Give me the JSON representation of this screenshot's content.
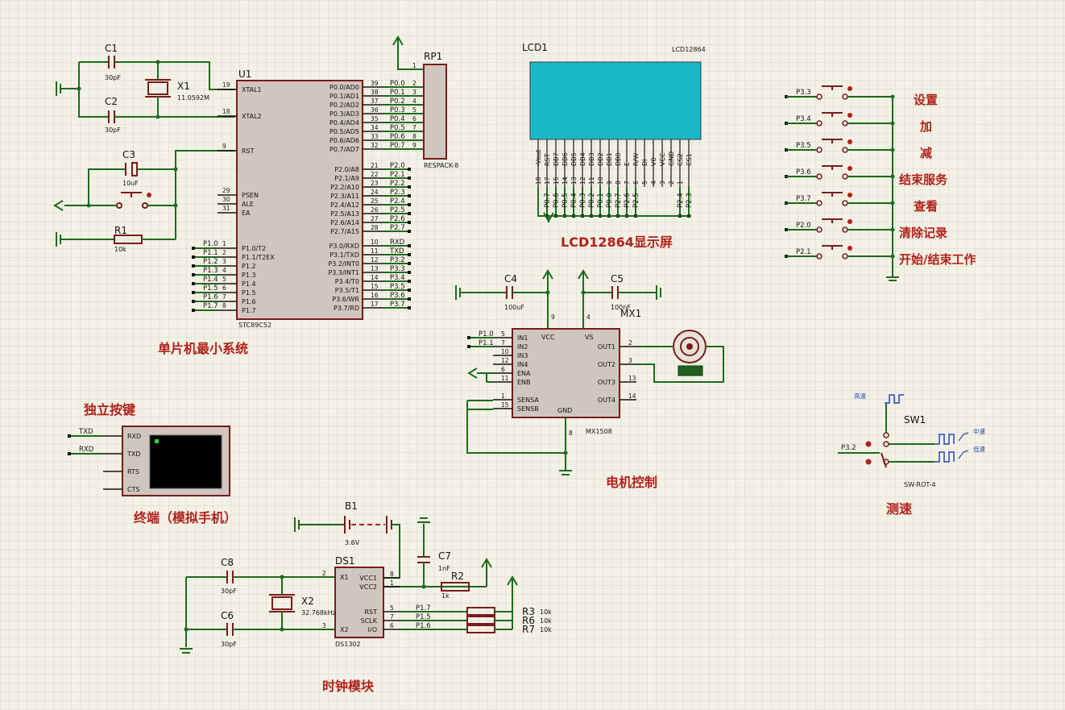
{
  "mcu": {
    "ref": "U1",
    "part": "STC89C52",
    "left_pins": [
      {
        "num": "19",
        "name": "XTAL1"
      },
      {
        "num": "18",
        "name": "XTAL2"
      },
      {
        "num": "9",
        "name": "RST"
      },
      {
        "num": "29",
        "name": "PSEN"
      },
      {
        "num": "30",
        "name": "ALE"
      },
      {
        "num": "31",
        "name": "EA"
      },
      {
        "num": "1",
        "name": "P1.0/T2"
      },
      {
        "num": "2",
        "name": "P1.1/T2EX"
      },
      {
        "num": "3",
        "name": "P1.2"
      },
      {
        "num": "4",
        "name": "P1.3"
      },
      {
        "num": "5",
        "name": "P1.4"
      },
      {
        "num": "6",
        "name": "P1.5"
      },
      {
        "num": "7",
        "name": "P1.6"
      },
      {
        "num": "8",
        "name": "P1.7"
      }
    ],
    "right_pins": [
      {
        "num": "39",
        "name": "P0.0/AD0",
        "net": "P0.0"
      },
      {
        "num": "38",
        "name": "P0.1/AD1",
        "net": "P0.1"
      },
      {
        "num": "37",
        "name": "P0.2/AD2",
        "net": "P0.2"
      },
      {
        "num": "36",
        "name": "P0.3/AD3",
        "net": "P0.3"
      },
      {
        "num": "35",
        "name": "P0.4/AD4",
        "net": "P0.4"
      },
      {
        "num": "34",
        "name": "P0.5/AD5",
        "net": "P0.5"
      },
      {
        "num": "33",
        "name": "P0.6/AD6",
        "net": "P0.6"
      },
      {
        "num": "32",
        "name": "P0.7/AD7",
        "net": "P0.7"
      },
      {
        "num": "21",
        "name": "P2.0/A8",
        "net": "P2.0"
      },
      {
        "num": "22",
        "name": "P2.1/A9",
        "net": "P2.1"
      },
      {
        "num": "23",
        "name": "P2.2/A10",
        "net": "P2.2"
      },
      {
        "num": "24",
        "name": "P2.3/A11",
        "net": "P2.3"
      },
      {
        "num": "25",
        "name": "P2.4/A12",
        "net": "P2.4"
      },
      {
        "num": "26",
        "name": "P2.5/A13",
        "net": "P2.5"
      },
      {
        "num": "27",
        "name": "P2.6/A14",
        "net": "P2.6"
      },
      {
        "num": "28",
        "name": "P2.7/A15",
        "net": "P2.7"
      },
      {
        "num": "10",
        "name": "P3.0/RXD",
        "net": "RXD"
      },
      {
        "num": "11",
        "name": "P3.1/TXD",
        "net": "TXD"
      },
      {
        "num": "12",
        "name": "P3.2/INT0",
        "net": "P3.2"
      },
      {
        "num": "13",
        "name": "P3.3/INT1",
        "net": "P3.3"
      },
      {
        "num": "14",
        "name": "P3.4/T0",
        "net": "P3.4"
      },
      {
        "num": "15",
        "name": "P3.5/T1",
        "net": "P3.5"
      },
      {
        "num": "16",
        "name": "P3.6/WR",
        "net": "P3.6"
      },
      {
        "num": "17",
        "name": "P3.7/RD",
        "net": "P3.7"
      }
    ],
    "p1_nets": [
      "P1.0",
      "P1.1",
      "P1.2",
      "P1.3",
      "P1.4",
      "P1.5",
      "P1.6",
      "P1.7"
    ]
  },
  "parts": {
    "c1": {
      "ref": "C1",
      "value": "30pF"
    },
    "c2": {
      "ref": "C2",
      "value": "30pF"
    },
    "c3": {
      "ref": "C3",
      "value": "10uF"
    },
    "x1": {
      "ref": "X1",
      "value": "11.0592M"
    },
    "r1": {
      "ref": "R1",
      "value": "10k"
    },
    "rp1": {
      "ref": "RP1",
      "value": "RESPACK-8",
      "pins": [
        "1",
        "2",
        "3",
        "4",
        "5",
        "6",
        "7",
        "8",
        "9"
      ]
    },
    "lcd": {
      "ref": "LCD1",
      "part": "LCD12864",
      "pins": [
        "-Vout",
        "RST",
        "DB7",
        "DB6",
        "DB5",
        "DB4",
        "DB3",
        "DB2",
        "DB1",
        "DB0",
        "E",
        "R/W",
        "DI",
        "V0",
        "VCC",
        "GND",
        "CS2",
        "CS1"
      ],
      "pin_nums": [
        "18",
        "17",
        "15",
        "14",
        "13",
        "12",
        "11",
        "10",
        "9",
        "8",
        "7",
        "6",
        "5",
        "4",
        "3",
        "2",
        "1",
        ""
      ],
      "nets": [
        "",
        "P0.7",
        "P0.6",
        "P0.5",
        "P0.4",
        "P0.3",
        "P0.2",
        "P0.1",
        "P0.0",
        "P2.7",
        "P2.6",
        "P2.5",
        "",
        "",
        "",
        "",
        "P2.4",
        "P2.3"
      ]
    },
    "c4": {
      "ref": "C4",
      "value": "100uF"
    },
    "c5": {
      "ref": "C5",
      "value": "100nF"
    },
    "mx1": {
      "ref": "MX1",
      "part": "MX1508",
      "left": [
        {
          "num": "5",
          "name": "IN1",
          "net": "P1.0"
        },
        {
          "num": "7",
          "name": "IN2",
          "net": "P1.1"
        },
        {
          "num": "10",
          "name": "IN3"
        },
        {
          "num": "12",
          "name": "IN4"
        },
        {
          "num": "6",
          "name": "ENA"
        },
        {
          "num": "11",
          "name": "ENB"
        },
        {
          "num": "1",
          "name": "SENSA"
        },
        {
          "num": "15",
          "name": "SENSB"
        }
      ],
      "right": [
        {
          "num": "2",
          "name": "OUT1"
        },
        {
          "num": "3",
          "name": "OUT2"
        },
        {
          "num": "13",
          "name": "OUT3"
        },
        {
          "num": "14",
          "name": "OUT4"
        }
      ],
      "top": [
        {
          "num": "9",
          "name": "VCC"
        },
        {
          "num": "4",
          "name": "VS"
        }
      ],
      "bottom": {
        "num": "8",
        "name": "GND"
      }
    },
    "b1": {
      "ref": "B1",
      "value": "3.6V"
    },
    "c7": {
      "ref": "C7",
      "value": "1nF"
    },
    "c8": {
      "ref": "C8",
      "value": "30pF"
    },
    "c6": {
      "ref": "C6",
      "value": "30pF"
    },
    "x2": {
      "ref": "X2",
      "value": "32.768kHz"
    },
    "r2": {
      "ref": "R2",
      "value": "1k"
    },
    "r3": {
      "ref": "R3",
      "value": "10k"
    },
    "r6": {
      "ref": "R6",
      "value": "10k"
    },
    "r7": {
      "ref": "R7",
      "value": "10k"
    },
    "ds1": {
      "ref": "DS1",
      "part": "DS1302",
      "left": [
        {
          "num": "2",
          "name": "X1"
        },
        {
          "num": "3",
          "name": "X2"
        }
      ],
      "right": [
        {
          "num": "8",
          "name": "VCC1"
        },
        {
          "num": "1",
          "name": "VCC2"
        },
        {
          "num": "5",
          "name": "RST",
          "net": "P1.7"
        },
        {
          "num": "7",
          "name": "SCLK",
          "net": "P1.5"
        },
        {
          "num": "6",
          "name": "I/O",
          "net": "P1.6"
        }
      ]
    },
    "sw1": {
      "ref": "SW1",
      "part": "SW-ROT-4",
      "input": "P3.2",
      "positions": [
        "高速",
        "中速",
        "低速"
      ]
    },
    "term": {
      "pins": [
        "RXD",
        "TXD",
        "RTS",
        "CTS"
      ],
      "nets": [
        "TXD",
        "RXD"
      ]
    }
  },
  "buttons": [
    {
      "net": "P3.3",
      "label": "设置"
    },
    {
      "net": "P3.4",
      "label": "加"
    },
    {
      "net": "P3.5",
      "label": "减"
    },
    {
      "net": "P3.6",
      "label": "结束服务"
    },
    {
      "net": "P3.7",
      "label": "查看"
    },
    {
      "net": "P2.0",
      "label": "清除记录"
    },
    {
      "net": "P2.1",
      "label": "开始/结束工作"
    }
  ],
  "sections": {
    "mcu": "单片机最小系统",
    "lcd": "LCD12864显示屏",
    "keys": "独立按键",
    "terminal": "终端（模拟手机）",
    "motor": "电机控制",
    "speed": "测速",
    "clock": "时钟模块"
  },
  "colors": {
    "background": "#f3f1e6",
    "grid": "#d9d6c8",
    "wire": "#1c6b1c",
    "body": "#cfc6bf",
    "outline": "#7a1b1b",
    "section_label": "#b0211a",
    "lcd_screen": "#19b8c8",
    "terminal_screen": "#000000"
  }
}
